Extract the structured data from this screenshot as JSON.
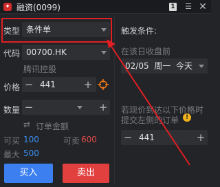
{
  "window": {
    "logo_glyph": "✦",
    "title": "融资(0099)",
    "badge": "1",
    "minimize_glyph": "☰",
    "close_glyph": "✕"
  },
  "left": {
    "type_label": "类型",
    "type_value": "条件单",
    "code_label": "代码",
    "code_value": "00700.HK",
    "stock_name": "腾讯控股",
    "price_label": "价格",
    "price_value": "441",
    "minus": "−",
    "plus": "+",
    "qty_label": "数量",
    "qty_value": "",
    "order_amount": "订单金额",
    "buyable_label": "可买",
    "buyable_value": "100",
    "sellable_label": "可卖",
    "sellable_value": "600",
    "max_label": "最大",
    "max_value": "500",
    "buy_button": "买入",
    "sell_button": "卖出"
  },
  "right": {
    "trigger_title": "触发条件:",
    "valid_before": "在该日收盘前",
    "date_value": "02/05  周一  今天",
    "condition_text_1": "若现价到达以下价格时",
    "condition_text_2": "提交左侧的订单",
    "trigger_price": "441",
    "warn_glyph": "!"
  },
  "colors": {
    "highlight": "#e01f24",
    "buy": "#3b7ff0",
    "sell": "#e23f3f",
    "buyable": "#3b8cf0",
    "sellable": "#e04a4a",
    "target_icon": "#f07a1a"
  }
}
